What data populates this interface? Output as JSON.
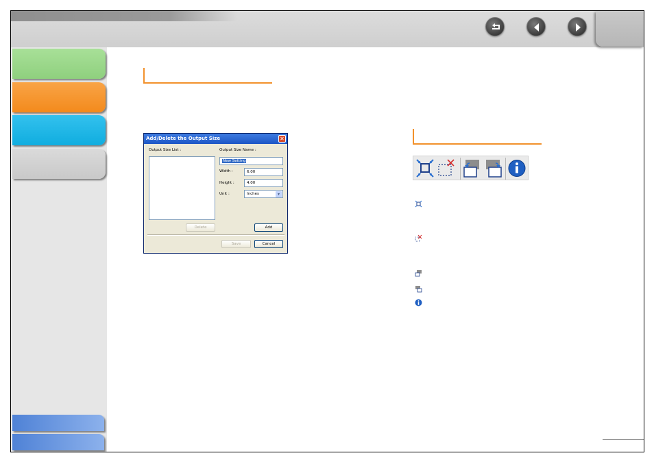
{
  "colors": {
    "tab_green": "#9ad88a",
    "tab_orange": "#f7962c",
    "tab_cyan": "#1ab6ea",
    "tab_gray": "#d2d2d2",
    "heading_accent": "#f2912b",
    "dialog_titlebar": "#2a62d4"
  },
  "nav": {
    "icons": [
      "back-return-icon",
      "previous-page-icon",
      "next-page-icon"
    ]
  },
  "dialog": {
    "title": "Add/Delete the Output Size",
    "list_label": "Output Size List :",
    "name_label": "Output Size Name :",
    "name_value": "New Setting",
    "width_label": "Width :",
    "width_value": "6.00",
    "height_label": "Height :",
    "height_value": "4.00",
    "unit_label": "Unit :",
    "unit_value": "Inches",
    "delete_label": "Delete",
    "add_label": "Add",
    "save_label": "Save",
    "cancel_label": "Cancel"
  },
  "toolbar": {
    "icons": [
      "auto-crop-icon",
      "clear-crop-icon",
      "rotate-left-icon",
      "rotate-right-icon",
      "information-icon"
    ]
  }
}
